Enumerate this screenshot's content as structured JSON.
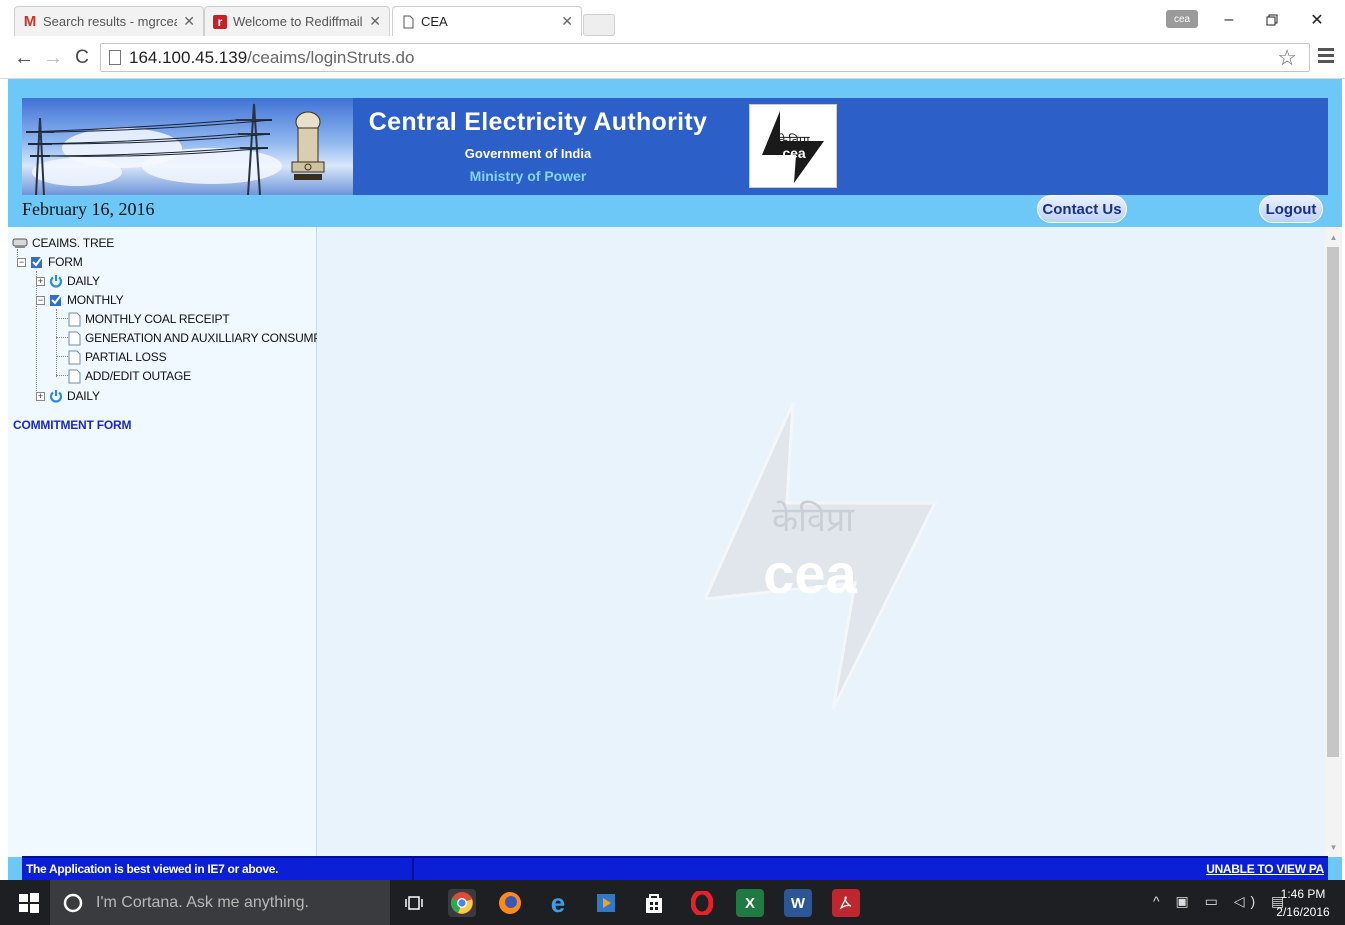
{
  "browser": {
    "tabs": [
      {
        "title": "Search results - mgrceaop",
        "icon": "gmail-icon"
      },
      {
        "title": "Welcome to Rediffmail:",
        "icon": "rediff-icon"
      },
      {
        "title": "CEA",
        "icon": "page-icon"
      }
    ],
    "active_tab": 2,
    "profile_badge": "cea",
    "url_host": "164.100.45.139",
    "url_path": "/ceaims/loginStruts.do"
  },
  "header": {
    "title": "Central Electricity Authority",
    "subtitle1": "Government of India",
    "subtitle2": "Ministry of Power",
    "logo_devanagari": "केविप्रा",
    "logo_text": "cea"
  },
  "subheader": {
    "date": "February 16, 2016",
    "contact_label": "Contact Us",
    "logout_label": "Logout"
  },
  "tree": {
    "root": "CEAIMS. TREE",
    "form": "FORM",
    "daily1": "DAILY",
    "monthly": "MONTHLY",
    "monthly_items": [
      "MONTHLY COAL RECEIPT",
      "GENERATION AND AUXILLIARY CONSUMPTION",
      "PARTIAL LOSS",
      "ADD/EDIT OUTAGE"
    ],
    "daily2": "DAILY"
  },
  "commitment_link": "COMMITMENT FORM",
  "watermark": {
    "devanagari": "केविप्रा",
    "text": "cea"
  },
  "statusbar": {
    "left": "The Application is best viewed in IE7 or above.",
    "right": "UNABLE TO VIEW PA"
  },
  "taskbar": {
    "search_placeholder": "I'm Cortana. Ask me anything.",
    "time": "1:46 PM",
    "date": "2/16/2016"
  },
  "colors": {
    "banner": "#2d5fc8",
    "page_bg": "#6ec8f7",
    "statusbar": "#0a1fd6",
    "link": "#1a28c8"
  }
}
